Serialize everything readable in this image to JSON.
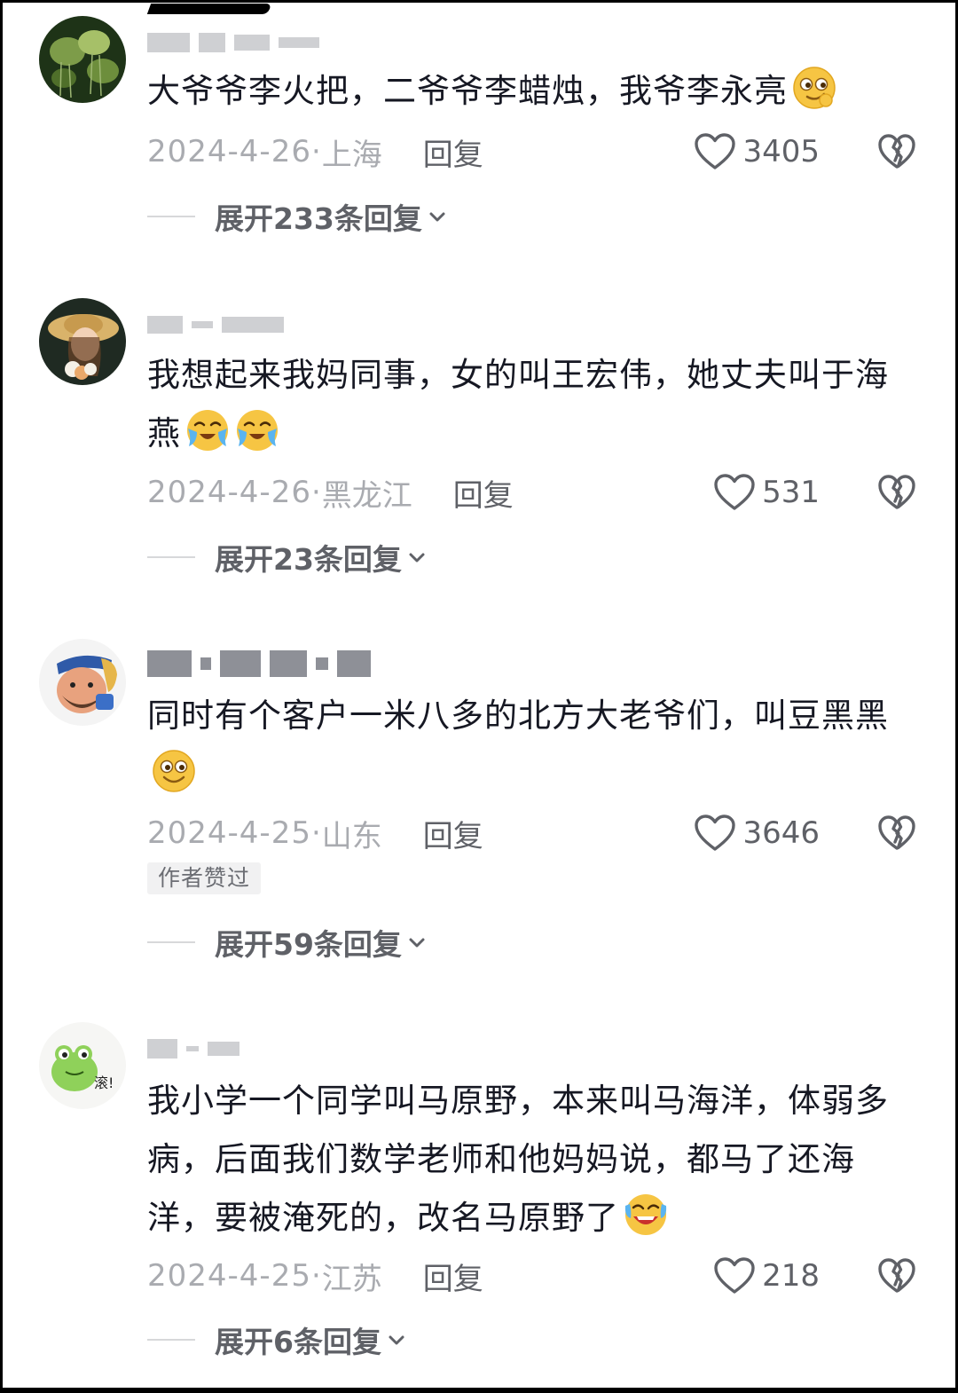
{
  "comments": [
    {
      "text": "大爷爷李火把，二爷爷李蜡烛，我爷李永亮",
      "emojis": [
        "sly-grin-emoji"
      ],
      "date": "2024-4-26·",
      "location": "上海",
      "reply_label": "回复",
      "likes": "3405",
      "expand_label": "展开233条回复"
    },
    {
      "text": "我想起来我妈同事，女的叫王宏伟，她丈夫叫于海燕",
      "emojis": [
        "crying-laugh-emoji",
        "crying-laugh-emoji"
      ],
      "date": "2024-4-26·",
      "location": "黑龙江",
      "reply_label": "回复",
      "likes": "531",
      "expand_label": "展开23条回复"
    },
    {
      "text": "同时有个客户一米八多的北方大老爷们，叫豆黑黑",
      "emojis": [
        "smile-emoji"
      ],
      "date": "2024-4-25·",
      "location": "山东",
      "reply_label": "回复",
      "likes": "3646",
      "badge": "作者赞过",
      "expand_label": "展开59条回复"
    },
    {
      "text": "我小学一个同学叫马原野，本来叫马海洋，体弱多病，后面我们数学老师和他妈妈说，都马了还海洋，要被淹死的，改名马原野了",
      "emojis": [
        "rolling-laugh-emoji"
      ],
      "date": "2024-4-25·",
      "location": "江苏",
      "reply_label": "回复",
      "likes": "218",
      "expand_label": "展开6条回复",
      "avatar_text": "滚!"
    }
  ],
  "colors": {
    "text": "#161823",
    "meta": "#a9abb0",
    "action": "#5f6167"
  }
}
